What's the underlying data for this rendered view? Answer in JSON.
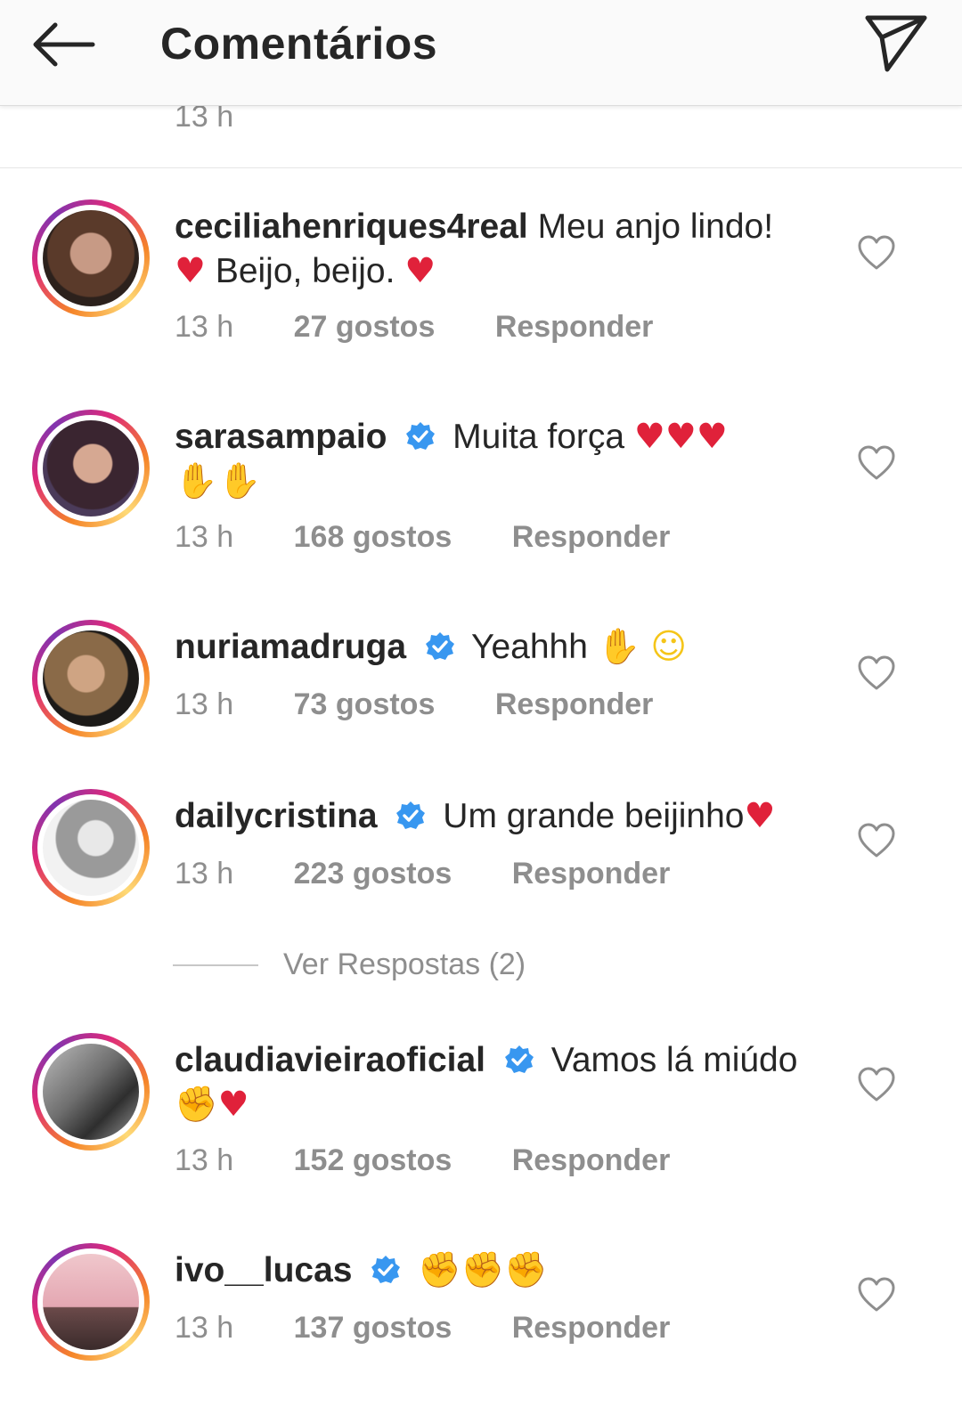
{
  "header": {
    "title": "Comentários"
  },
  "previous_time": "13 h",
  "comments": [
    {
      "username": "ceciliahenriques4real",
      "verified": false,
      "text": "Meu anjo lindo!",
      "line2": "Beijo, beijo.",
      "time": "13 h",
      "likes": "27 gostos",
      "reply": "Responder"
    },
    {
      "username": "sarasampaio",
      "verified": true,
      "text": "Muita força",
      "time": "13 h",
      "likes": "168 gostos",
      "reply": "Responder"
    },
    {
      "username": "nuriamadruga",
      "verified": true,
      "text": "Yeahhh",
      "time": "13 h",
      "likes": "73 gostos",
      "reply": "Responder"
    },
    {
      "username": "dailycristina",
      "verified": true,
      "text": "Um grande beijinho",
      "time": "13 h",
      "likes": "223 gostos",
      "reply": "Responder"
    },
    {
      "username": "claudiavieiraoficial",
      "verified": true,
      "text": "Vamos lá miúdo",
      "time": "13 h",
      "likes": "152 gostos",
      "reply": "Responder"
    },
    {
      "username": "ivo__lucas",
      "verified": true,
      "text": "",
      "time": "13 h",
      "likes": "137 gostos",
      "reply": "Responder"
    }
  ],
  "view_replies": "Ver Respostas (2)",
  "colors": {
    "accent_verified": "#3897f0",
    "text_primary": "#262626",
    "text_secondary": "#8e8e8e",
    "heart_red": "#e0213a"
  }
}
